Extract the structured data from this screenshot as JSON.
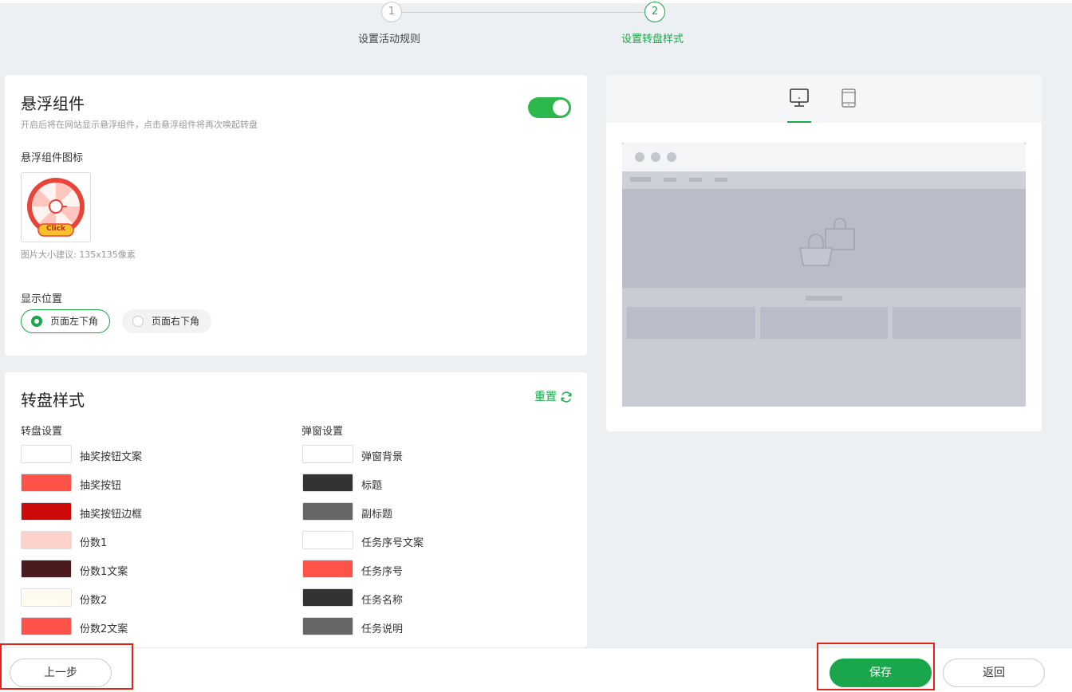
{
  "steps": [
    {
      "number": "1",
      "label": "设置活动规则"
    },
    {
      "number": "2",
      "label": "设置转盘样式"
    }
  ],
  "floating": {
    "title": "悬浮组件",
    "description": "开启后将在网站显示悬浮组件，点击悬浮组件将再次唤起转盘",
    "toggle_on": true,
    "icon_label": "悬浮组件图标",
    "icon_badge_text": "Click",
    "size_hint": "图片大小建议: 135x135像素",
    "position_label": "显示位置",
    "positions": [
      {
        "label": "页面左下角",
        "selected": true
      },
      {
        "label": "页面右下角",
        "selected": false
      }
    ]
  },
  "wheel_style": {
    "title": "转盘样式",
    "reset_label": "重置",
    "wheel_settings_label": "转盘设置",
    "popup_settings_label": "弹窗设置",
    "wheel_items": [
      {
        "label": "抽奖按钮文案",
        "color": "#ffffff"
      },
      {
        "label": "抽奖按钮",
        "color": "#ff5249"
      },
      {
        "label": "抽奖按钮边框",
        "color": "#cc0a0a"
      },
      {
        "label": "份数1",
        "color": "#ffd1ca"
      },
      {
        "label": "份数1文案",
        "color": "#4a1a1e"
      },
      {
        "label": "份数2",
        "color": "#fffbee"
      },
      {
        "label": "份数2文案",
        "color": "#ff5249"
      }
    ],
    "popup_items": [
      {
        "label": "弹窗背景",
        "color": "#ffffff"
      },
      {
        "label": "标题",
        "color": "#333333"
      },
      {
        "label": "副标题",
        "color": "#666666"
      },
      {
        "label": "任务序号文案",
        "color": "#ffffff"
      },
      {
        "label": "任务序号",
        "color": "#ff5249"
      },
      {
        "label": "任务名称",
        "color": "#333333"
      },
      {
        "label": "任务说明",
        "color": "#666666"
      }
    ]
  },
  "preview": {
    "tabs": [
      {
        "icon": "desktop-icon",
        "active": true
      },
      {
        "icon": "tablet-icon",
        "active": false
      }
    ]
  },
  "footer": {
    "prev_label": "上一步",
    "save_label": "保存",
    "back_label": "返回"
  },
  "colors": {
    "accent": "#1aa64a",
    "highlight_box": "#e2231a"
  }
}
